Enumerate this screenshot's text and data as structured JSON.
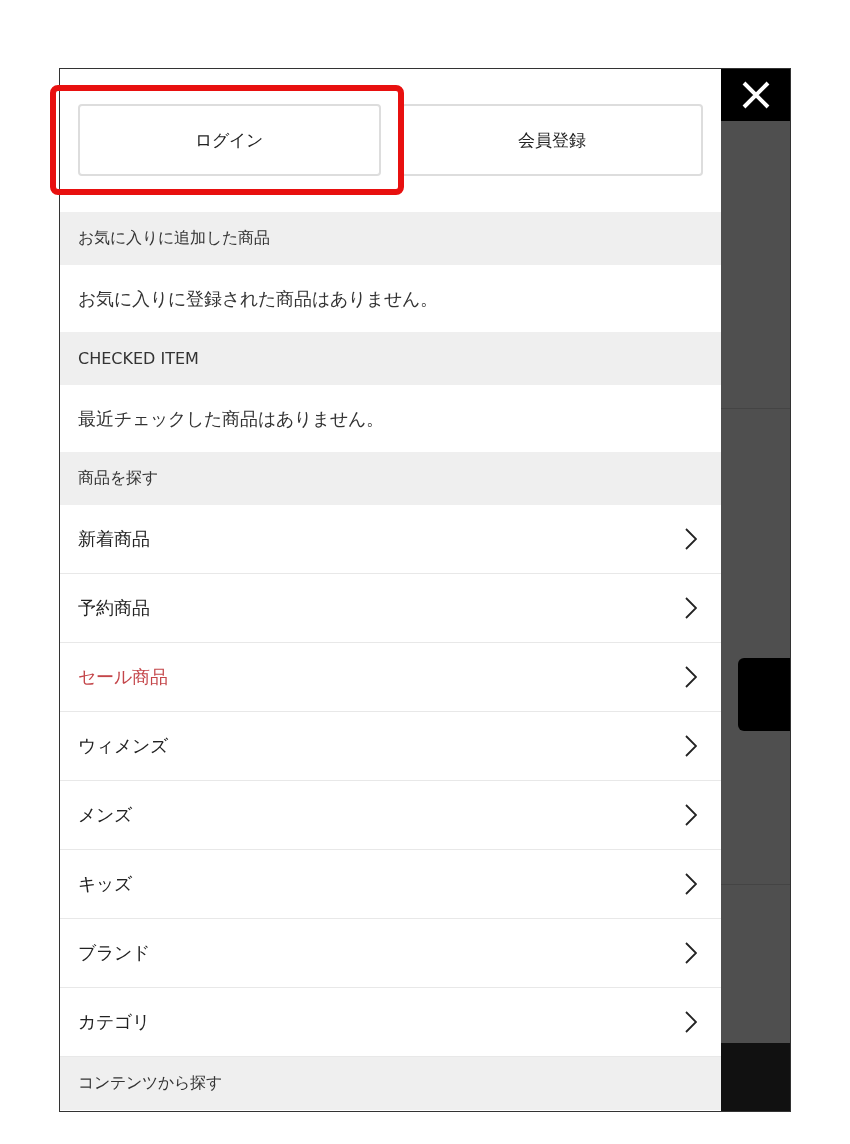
{
  "auth_buttons": [
    {
      "label": "ログイン",
      "highlighted": true
    },
    {
      "label": "会員登録",
      "highlighted": false
    }
  ],
  "menu": [
    {
      "kind": "header",
      "text": "お気に入りに追加した商品"
    },
    {
      "kind": "message",
      "text": "お気に入りに登録された商品はありません。"
    },
    {
      "kind": "header",
      "text": "CHECKED ITEM"
    },
    {
      "kind": "message",
      "text": "最近チェックした商品はありません。"
    },
    {
      "kind": "header",
      "text": "商品を探す"
    },
    {
      "kind": "link",
      "text": "新着商品",
      "color": "#222222"
    },
    {
      "kind": "link",
      "text": "予約商品",
      "color": "#222222"
    },
    {
      "kind": "link",
      "text": "セール商品",
      "color": "#c4464a"
    },
    {
      "kind": "link",
      "text": "ウィメンズ",
      "color": "#222222"
    },
    {
      "kind": "link",
      "text": "メンズ",
      "color": "#222222"
    },
    {
      "kind": "link",
      "text": "キッズ",
      "color": "#222222"
    },
    {
      "kind": "link",
      "text": "ブランド",
      "color": "#222222"
    },
    {
      "kind": "link",
      "text": "カテゴリ",
      "color": "#222222"
    },
    {
      "kind": "header",
      "text": "コンテンツから探す"
    }
  ]
}
